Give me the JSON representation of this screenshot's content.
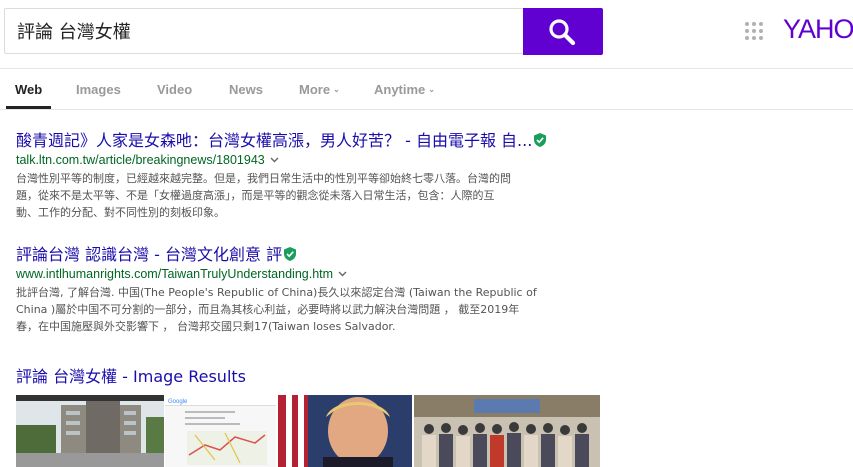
{
  "search": {
    "query": "評論 台灣女權"
  },
  "brand": {
    "logo_text": "YAHOO",
    "accent": "#6001d2"
  },
  "tabs": [
    {
      "label": "Web",
      "active": true
    },
    {
      "label": "Images"
    },
    {
      "label": "Video"
    },
    {
      "label": "News"
    },
    {
      "label": "More",
      "chevron": true
    },
    {
      "label": "Anytime",
      "chevron": true
    }
  ],
  "results": [
    {
      "title": "酸青週記》人家是女森吔：台灣女權高漲，男人好苦？ - 自由電子報 自...",
      "url": "talk.ltn.com.tw/article/breakingnews/1801943",
      "snippet_lines": [
        "台灣性別平等的制度，已經越來越完整。但是，我們日常生活中的性別平等卻始終七零八落。台灣的問",
        "題，從來不是太平等、不是「女權過度高漲」，而是平等的觀念從未落入日常生活，包含：人際的互",
        "動、工作的分配、對不同性別的刻板印象。"
      ]
    },
    {
      "title": "評論台灣 認識台灣 - 台灣文化創意 評",
      "url": "www.intlhumanrights.com/TaiwanTrulyUnderstanding.htm",
      "snippet_lines": [
        "批評台灣, 了解台灣. 中国(The People's Republic of China)長久以來認定台灣 (Taiwan the Republic of",
        "China )屬於中国不可分割的一部分，而且為其核心利益，必要時將以武力解決台灣問題 ， 截至2019年",
        "春，在中国施壓與外交影響下 ， 台灣邦交國只剩17(Taiwan loses Salvador."
      ]
    }
  ],
  "image_results": {
    "title": "評論 台灣女權 - Image Results"
  }
}
